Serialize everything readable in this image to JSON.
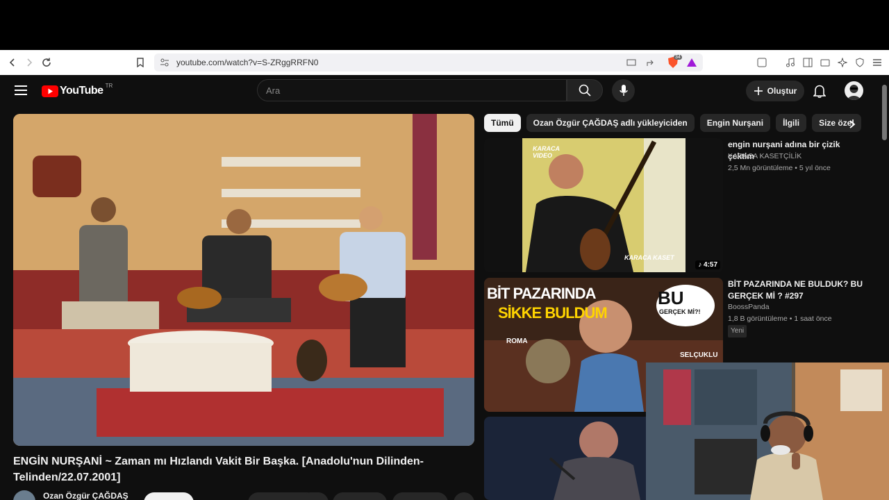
{
  "browser": {
    "url": "youtube.com/watch?v=S-ZRggRRFN0",
    "brave_badge": "34"
  },
  "masthead": {
    "logo_text": "YouTube",
    "country_code": "TR",
    "search_placeholder": "Ara",
    "create_label": "Oluştur"
  },
  "chips": [
    {
      "label": "Tümü"
    },
    {
      "label": "Ozan Özgür ÇAĞDAŞ adlı yükleyiciden"
    },
    {
      "label": "Engin Nurşani"
    },
    {
      "label": "İlgili"
    },
    {
      "label": "Size özel"
    }
  ],
  "video": {
    "title": "ENGİN NURŞANİ ~ Zaman mı Hızlandı Vakit Bir Başka. [Anadolu'nun Dilinden-Telinden/22.07.2001]",
    "channel": "Ozan Özgür ÇAĞDAŞ"
  },
  "recommendations": [
    {
      "title": "engin nurşani adına bir çizik çektim",
      "channel": "KARACA KASETÇİLİK",
      "meta": "2,5 Mn görüntüleme • 5 yıl önce",
      "duration": "4:57",
      "thumb_text_top": "KARACA VIDEO",
      "thumb_text_bottom": "KARACA KASET"
    },
    {
      "title": "BİT PAZARINDA NE BULDUK? BU GERÇEK Mİ ? #297",
      "channel": "BoossPanda",
      "meta": "1,8 B görüntüleme • 1 saat önce",
      "badge": "Yeni",
      "thumb_line1": "BİT PAZARINDA",
      "thumb_line2": "SİKKE BULDUM",
      "thumb_bubble1": "BU",
      "thumb_bubble2": "GERÇEK Mİ?!",
      "thumb_label_left": "ROMA",
      "thumb_label_right": "SELÇUKLU"
    }
  ]
}
